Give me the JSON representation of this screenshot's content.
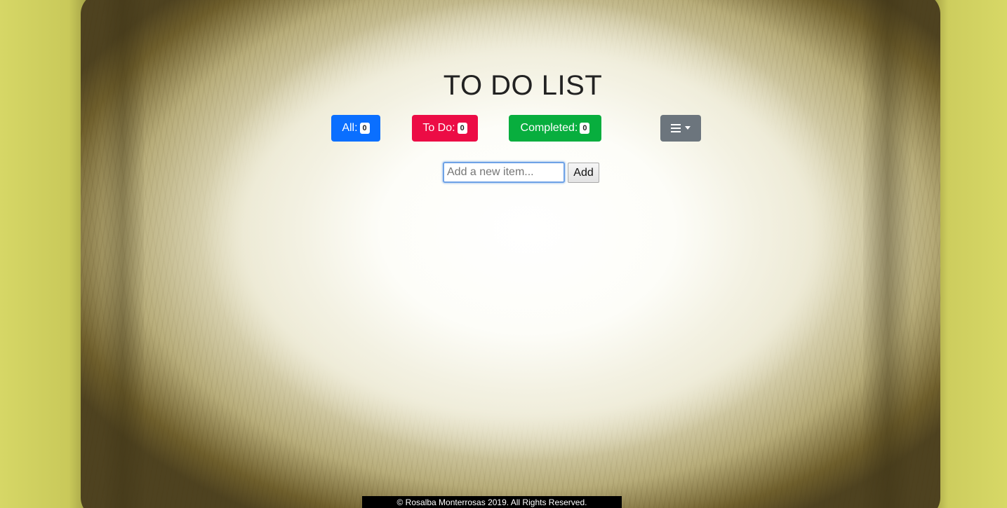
{
  "page": {
    "title": "TO DO LIST"
  },
  "counters": {
    "all": {
      "label": "All:",
      "count": "0",
      "color": "#0a6fff"
    },
    "todo": {
      "label": "To Do:",
      "count": "0",
      "color": "#ec0c45"
    },
    "completed": {
      "label": "Completed:",
      "count": "0",
      "color": "#08ae3e"
    }
  },
  "menu": {
    "icon": "hamburger-icon",
    "color": "#6c757d"
  },
  "form": {
    "input_placeholder": "Add a new item...",
    "input_value": "",
    "add_label": "Add"
  },
  "footer": {
    "text": "© Rosalba Monterrosas 2019. All Rights Reserved."
  }
}
